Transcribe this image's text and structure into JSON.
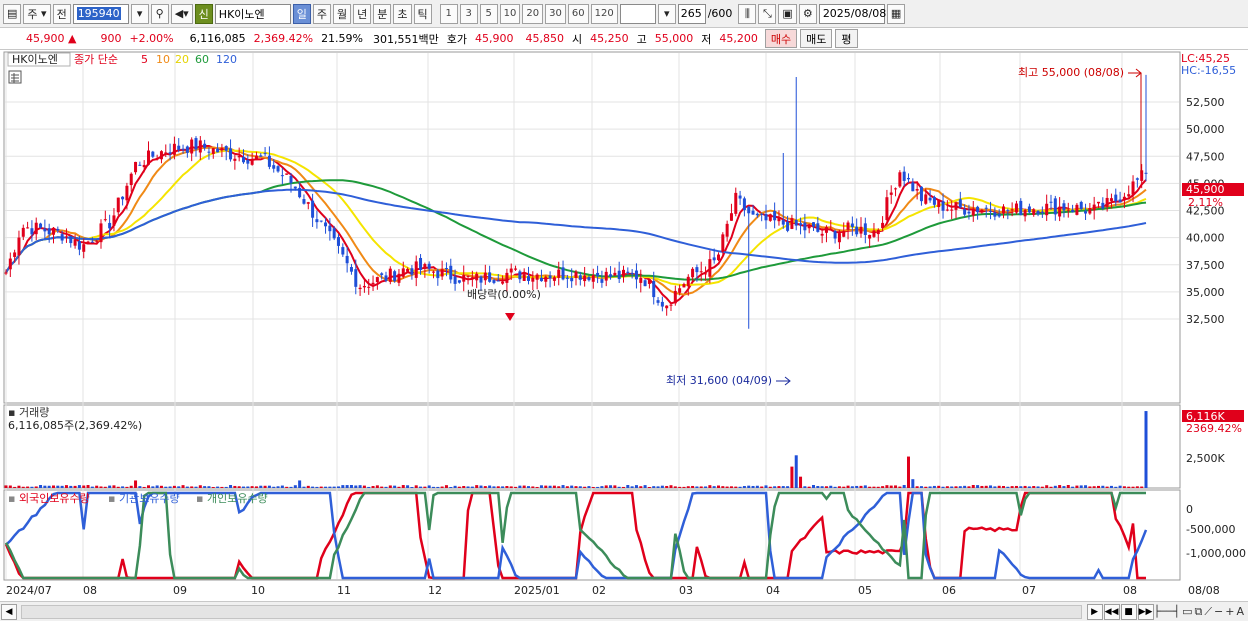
{
  "toolbar": {
    "period_primary": "주",
    "period_prev": "전",
    "stock_code": "195940",
    "new_badge": "신",
    "stock_name": "HK이노엔",
    "period_tabs": [
      "일",
      "주",
      "월",
      "년",
      "분",
      "초",
      "틱"
    ],
    "active_period": "일",
    "minute_buttons": [
      "1",
      "3",
      "5",
      "10",
      "20",
      "30",
      "60",
      "120"
    ],
    "count_value": "265",
    "count_max": "/600",
    "date_value": "2025/08/08"
  },
  "quote": {
    "price": "45,900",
    "change_arrow": "▲",
    "change": "900",
    "change_pct": "+2.00%",
    "volume": "6,116,085",
    "volume_pct": "2,369.42%",
    "turnover": "21.59%",
    "amount": "301,551백만",
    "bid_label": "호가",
    "bid": "45,900",
    "ask": "45,850",
    "open_label": "시",
    "open": "45,250",
    "high_label": "고",
    "high": "55,000",
    "low_label": "저",
    "low": "45,200",
    "buy_label": "매수",
    "sell_label": "매도",
    "eval_label": "평"
  },
  "legend": {
    "stock": "HK이노엔",
    "ma_label": "종가 단순",
    "ma_periods": [
      "5",
      "10",
      "20",
      "60",
      "120"
    ]
  },
  "price_panel": {
    "lc_label": "LC:45,25",
    "hc_label": "HC:-16,55",
    "current_badge": "45,900",
    "current_pct": "2.11%",
    "high_annotation": "최고 55,000 (08/08)",
    "low_annotation": "최저 31,600 (04/09)",
    "dividend_annotation": "배당락(0.00%)",
    "y_ticks": [
      "52,500",
      "50,000",
      "47,500",
      "45,000",
      "42,500",
      "40,000",
      "37,500",
      "35,000",
      "32,500"
    ]
  },
  "volume_panel": {
    "title": "거래량",
    "value_label": "6,116,085주(2,369.42%)",
    "badge": "6,116K",
    "badge_pct": "2369.42%",
    "y_tick": "2,500K"
  },
  "holdings_panel": {
    "legend": [
      "외국인보유수량",
      "기관보유수량",
      "개인보유수량"
    ],
    "y_ticks": [
      "0",
      "-500,000",
      "-1,000,000"
    ]
  },
  "x_axis": {
    "labels": [
      "2024/07",
      "08",
      "09",
      "10",
      "11",
      "12",
      "2025/01",
      "02",
      "03",
      "04",
      "05",
      "06",
      "07",
      "08",
      "08/08"
    ]
  },
  "colors": {
    "up": "#e0001b",
    "down": "#1f4fd8",
    "ma5": "#e0001b",
    "ma10": "#f08a16",
    "ma20": "#f5e400",
    "ma60": "#1e9a3a",
    "ma120": "#2f5fd8",
    "foreign": "#e0001b",
    "institution": "#3c8c5a",
    "individual": "#2f5fd8"
  }
}
